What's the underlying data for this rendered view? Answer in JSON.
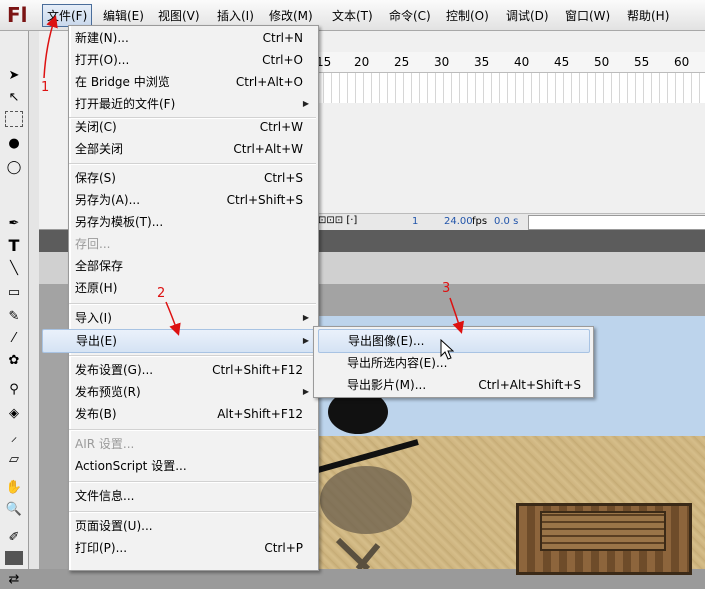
{
  "app": {
    "logo": "Fl"
  },
  "menubar": {
    "items": [
      "文件(F)",
      "编辑(E)",
      "视图(V)",
      "插入(I)",
      "修改(M)",
      "文本(T)",
      "命令(C)",
      "控制(O)",
      "调试(D)",
      "窗口(W)",
      "帮助(H)"
    ]
  },
  "timeline": {
    "ruler": [
      "15",
      "20",
      "25",
      "30",
      "35",
      "40",
      "45",
      "50",
      "55",
      "60"
    ],
    "frame": "1",
    "fps": "24.00",
    "fps_unit": "fps",
    "time": "0.0 s"
  },
  "file_menu": {
    "items": [
      {
        "label": "新建(N)...",
        "shortcut": "Ctrl+N"
      },
      {
        "label": "打开(O)...",
        "shortcut": "Ctrl+O"
      },
      {
        "label": "在 Bridge 中浏览",
        "shortcut": "Ctrl+Alt+O"
      },
      {
        "label": "打开最近的文件(F)",
        "shortcut": ""
      },
      {
        "label": "关闭(C)",
        "shortcut": "Ctrl+W"
      },
      {
        "label": "全部关闭",
        "shortcut": "Ctrl+Alt+W"
      },
      {
        "label": "保存(S)",
        "shortcut": "Ctrl+S"
      },
      {
        "label": "另存为(A)...",
        "shortcut": "Ctrl+Shift+S"
      },
      {
        "label": "另存为模板(T)...",
        "shortcut": ""
      },
      {
        "label": "存回...",
        "shortcut": ""
      },
      {
        "label": "全部保存",
        "shortcut": ""
      },
      {
        "label": "还原(H)",
        "shortcut": ""
      },
      {
        "label": "导入(I)",
        "shortcut": ""
      },
      {
        "label": "导出(E)",
        "shortcut": ""
      },
      {
        "label": "发布设置(G)...",
        "shortcut": "Ctrl+Shift+F12"
      },
      {
        "label": "发布预览(R)",
        "shortcut": ""
      },
      {
        "label": "发布(B)",
        "shortcut": "Alt+Shift+F12"
      },
      {
        "label": "AIR 设置...",
        "shortcut": ""
      },
      {
        "label": "ActionScript 设置...",
        "shortcut": ""
      },
      {
        "label": "文件信息...",
        "shortcut": ""
      },
      {
        "label": "页面设置(U)...",
        "shortcut": ""
      },
      {
        "label": "打印(P)...",
        "shortcut": "Ctrl+P"
      }
    ]
  },
  "export_submenu": {
    "items": [
      {
        "label": "导出图像(E)...",
        "shortcut": ""
      },
      {
        "label": "导出所选内容(E)...",
        "shortcut": ""
      },
      {
        "label": "导出影片(M)...",
        "shortcut": "Ctrl+Alt+Shift+S"
      }
    ]
  },
  "annotations": {
    "step1": "1",
    "step2": "2",
    "step3": "3"
  },
  "colors": {
    "annotation": "#dd1111",
    "highlight": "#d5e3f4",
    "sky": "#bdd4ec"
  }
}
